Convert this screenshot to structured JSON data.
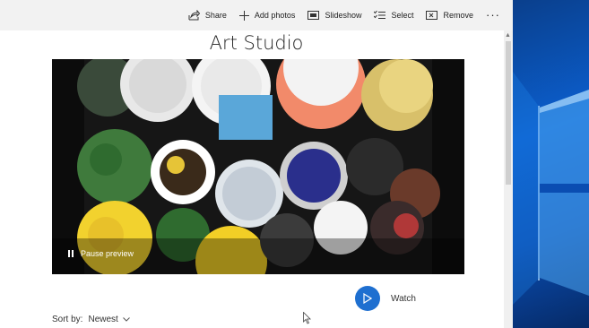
{
  "toolbar": {
    "share_label": "Share",
    "add_photos_label": "Add photos",
    "slideshow_label": "Slideshow",
    "select_label": "Select",
    "remove_label": "Remove",
    "more_label": "···"
  },
  "album": {
    "title": "Art Studio",
    "pause_label": "Pause preview",
    "watch_label": "Watch"
  },
  "sort": {
    "label": "Sort by:",
    "value": "Newest"
  },
  "colors": {
    "accent": "#1e6fd0",
    "toolbar_bg": "#f2f2f2",
    "desktop_blue": "#0b5fcf"
  }
}
